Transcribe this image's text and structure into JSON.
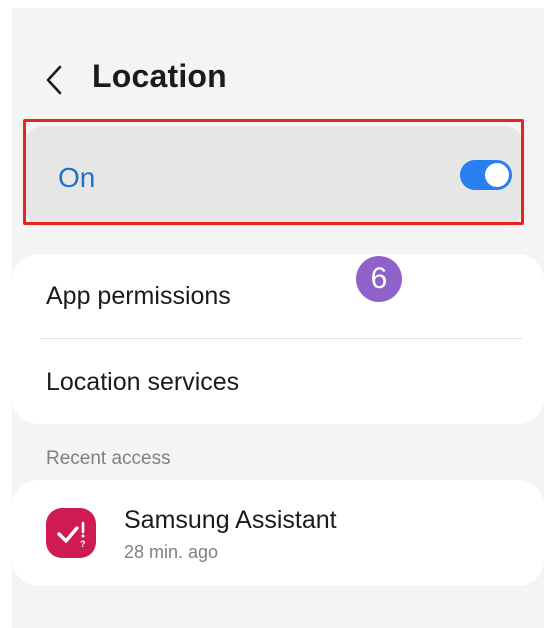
{
  "header": {
    "title": "Location",
    "back_icon": "chevron-left-icon"
  },
  "master_switch": {
    "label": "On",
    "state": "on",
    "highlighted": true
  },
  "annotation": {
    "step_number": "6"
  },
  "options": [
    {
      "label": "App permissions"
    },
    {
      "label": "Location services"
    }
  ],
  "recent_access": {
    "section_title": "Recent access",
    "apps": [
      {
        "name": "Samsung Assistant",
        "time": "28 min. ago",
        "icon": "samsung-assistant-icon"
      }
    ]
  },
  "colors": {
    "accent": "#1a73c8",
    "toggle_on": "#2a7ff0",
    "highlight": "#e8231f",
    "step_badge": "#8e62c8",
    "app_icon": "#cf1b52"
  }
}
